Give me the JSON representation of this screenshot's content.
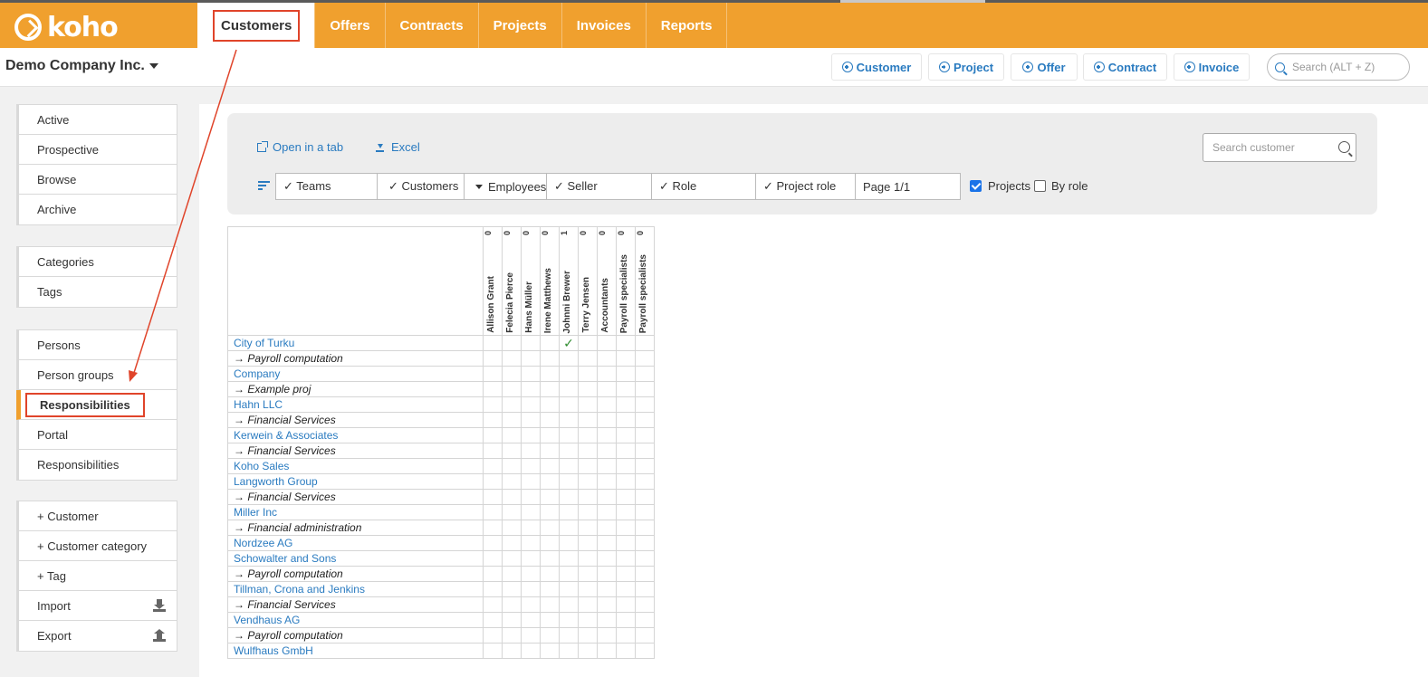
{
  "app": {
    "logo_text": "koho",
    "company": "Demo Company Inc."
  },
  "nav": [
    "Customers",
    "Offers",
    "Contracts",
    "Projects",
    "Invoices",
    "Reports"
  ],
  "quick_actions": [
    "Customer",
    "Project",
    "Offer",
    "Contract",
    "Invoice"
  ],
  "global_search": {
    "placeholder": "Search (ALT + Z)"
  },
  "sidebar": {
    "group1": [
      "Active",
      "Prospective",
      "Browse",
      "Archive"
    ],
    "group2": [
      "Categories",
      "Tags"
    ],
    "group3": [
      "Persons",
      "Person groups",
      "Responsibilities",
      "Portal",
      "Responsibilities"
    ],
    "group4": [
      "+ Customer",
      "+ Customer category",
      "+ Tag",
      "Import",
      "Export"
    ]
  },
  "toolbar": {
    "open_tab": "Open in a tab",
    "excel": "Excel",
    "search_placeholder": "Search customer",
    "filters": [
      "✓ Teams",
      "✓ Customers",
      "Employees",
      "✓ Seller",
      "✓ Role",
      "✓ Project role",
      "Page 1/1"
    ],
    "projects_label": "Projects",
    "by_role_label": "By role"
  },
  "table": {
    "columns": [
      {
        "count": "0",
        "name": "Allison Grant"
      },
      {
        "count": "0",
        "name": "Felecia Pierce"
      },
      {
        "count": "0",
        "name": "Hans Müller"
      },
      {
        "count": "0",
        "name": "Irene Matthews"
      },
      {
        "count": "1",
        "name": "Johnni Brewer"
      },
      {
        "count": "0",
        "name": "Terry Jensen"
      },
      {
        "count": "0",
        "name": "Accountants"
      },
      {
        "count": "0",
        "name": "Payroll specialists"
      },
      {
        "count": "0",
        "name": "Payroll specialists"
      }
    ],
    "rows": [
      {
        "label": "City of Turku",
        "project": false,
        "check_col": 4
      },
      {
        "label": "→ Payroll computation",
        "project": true
      },
      {
        "label": "Company",
        "project": false
      },
      {
        "label": "→ Example proj",
        "project": true
      },
      {
        "label": "Hahn LLC",
        "project": false
      },
      {
        "label": "→ Financial Services",
        "project": true
      },
      {
        "label": "Kerwein & Associates",
        "project": false
      },
      {
        "label": "→ Financial Services",
        "project": true
      },
      {
        "label": "Koho Sales",
        "project": false
      },
      {
        "label": "Langworth Group",
        "project": false
      },
      {
        "label": "→ Financial Services",
        "project": true
      },
      {
        "label": "Miller Inc",
        "project": false
      },
      {
        "label": "→ Financial administration",
        "project": true
      },
      {
        "label": "Nordzee AG",
        "project": false
      },
      {
        "label": "Schowalter and Sons",
        "project": false
      },
      {
        "label": "→ Payroll computation",
        "project": true
      },
      {
        "label": "Tillman, Crona and Jenkins",
        "project": false
      },
      {
        "label": "→ Financial Services",
        "project": true
      },
      {
        "label": "Vendhaus AG",
        "project": false
      },
      {
        "label": "→ Payroll computation",
        "project": true
      },
      {
        "label": "Wulfhaus GmbH",
        "project": false
      }
    ],
    "check_glyph": "✓"
  },
  "colors": {
    "brand": "#f0a02e",
    "link": "#2a7bc0",
    "highlight": "#e0442a",
    "check": "#2e8b2e"
  }
}
